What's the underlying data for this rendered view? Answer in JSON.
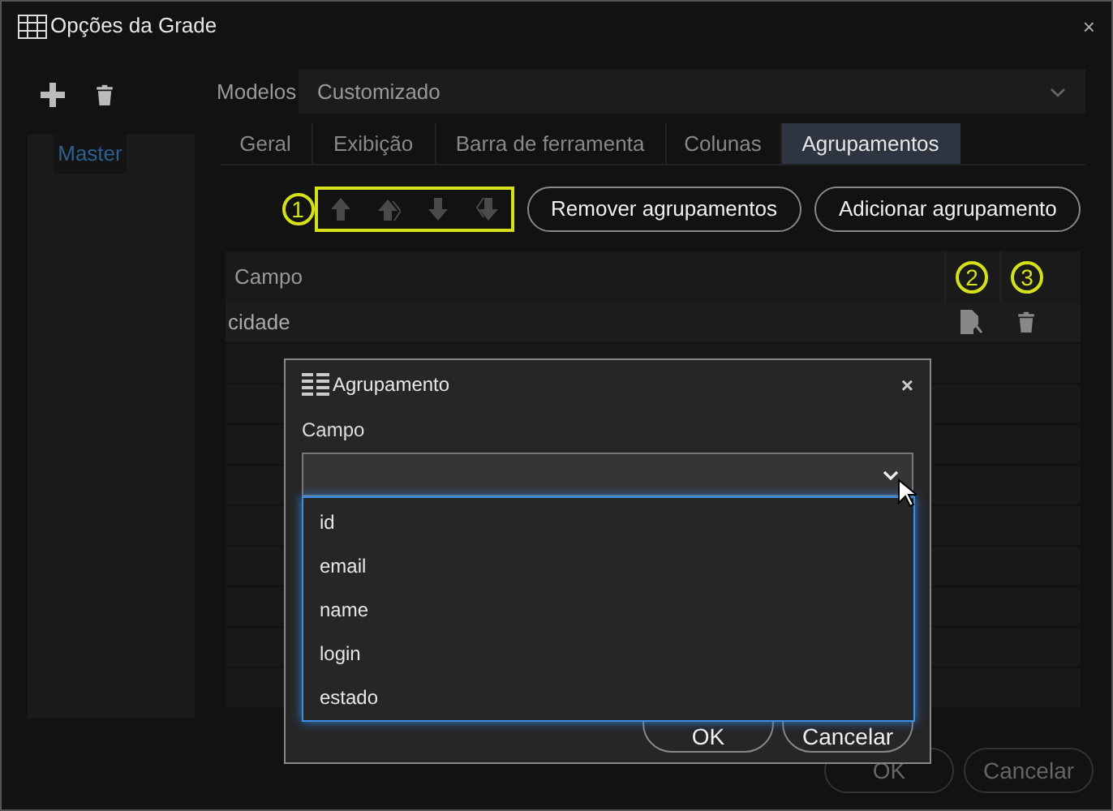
{
  "window": {
    "title": "Opções da Grade",
    "close": "×"
  },
  "sidebar": {
    "items": [
      {
        "label": "Master",
        "selected": true
      }
    ]
  },
  "models": {
    "label": "Modelos",
    "value": "Customizado"
  },
  "tabs": [
    {
      "label": "Geral",
      "selected": false
    },
    {
      "label": "Exibição",
      "selected": false
    },
    {
      "label": "Barra de ferramenta",
      "selected": false
    },
    {
      "label": "Colunas",
      "selected": false
    },
    {
      "label": "Agrupamentos",
      "selected": true
    }
  ],
  "toolbar": {
    "callout": "1",
    "move_buttons": [
      {
        "kind": "up",
        "disabled": true
      },
      {
        "kind": "top",
        "disabled": true
      },
      {
        "kind": "down",
        "disabled": true
      },
      {
        "kind": "bottom",
        "disabled": true
      }
    ],
    "buttons": [
      "Remover agrupamentos",
      "Adicionar agrupamento"
    ]
  },
  "table": {
    "columns": [
      "Campo"
    ],
    "callouts": [
      "2",
      "3"
    ],
    "rows": [
      {
        "campo": "cidade"
      }
    ]
  },
  "dialog": {
    "title": "Agrupamento",
    "close": "×",
    "field_label": "Campo",
    "dropdown": {
      "expanded": true,
      "options": [
        {
          "label": "id"
        },
        {
          "label": "email"
        },
        {
          "label": "name"
        },
        {
          "label": "login"
        },
        {
          "label": "estado"
        }
      ]
    },
    "buttons": [
      "OK",
      "Cancelar"
    ]
  },
  "footer": {
    "buttons": [
      "OK",
      "Cancelar"
    ]
  }
}
